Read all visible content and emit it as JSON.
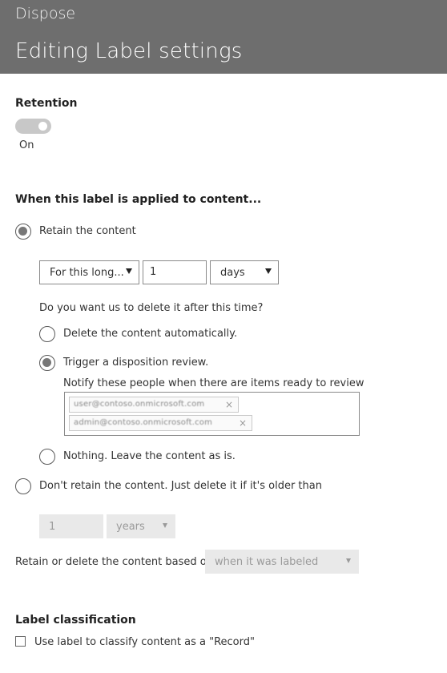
{
  "header": {
    "breadcrumb": "Dispose",
    "title": "Editing Label settings"
  },
  "retention": {
    "title": "Retention",
    "toggle_state": "On"
  },
  "applied": {
    "title": "When this label is applied to content...",
    "retain_label": "Retain the content",
    "duration_select": "For this long...",
    "duration_value": "1",
    "unit_select": "days",
    "delete_question": "Do you want us to delete it after this time?",
    "delete_auto_label": "Delete the content automatically.",
    "trigger_review_label": "Trigger a disposition review.",
    "notify_label": "Notify these people when there are items ready to review",
    "reviewers": [
      {
        "name": "user@contoso.onmicrosoft.com",
        "remove": "×"
      },
      {
        "name": "admin@contoso.onmicrosoft.com",
        "remove": "×"
      }
    ],
    "nothing_label": "Nothing. Leave the content as is.",
    "dont_retain_label": "Don't retain the content. Just delete it if it's older than",
    "delete_after_value": "1",
    "delete_after_unit": "years",
    "based_on_label": "Retain or delete the content based on",
    "based_on_select": "when it was labeled"
  },
  "classification": {
    "title": "Label classification",
    "record_label": "Use label to classify content as a \"Record\""
  },
  "colors": {
    "header_bg": "#6e6e6e",
    "toggle_bg": "#c8c8c8",
    "disabled_bg": "#e9e9e9"
  }
}
